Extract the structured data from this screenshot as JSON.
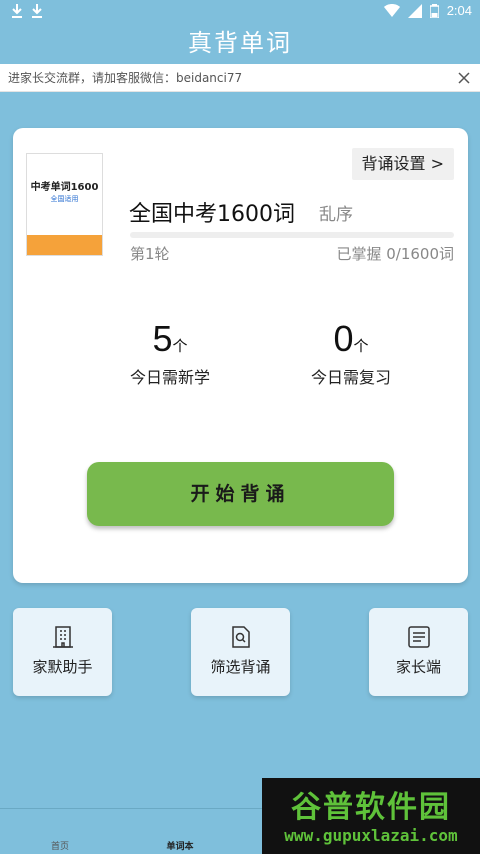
{
  "status_bar": {
    "time": "2:04"
  },
  "header": {
    "title": "真背单词"
  },
  "notice": {
    "text": "进家长交流群，请加客服微信：beidanci77"
  },
  "book": {
    "cover_title": "中考单词1600",
    "cover_subtitle": "全国适用",
    "name": "全国中考1600词",
    "order": "乱序",
    "round": "第1轮",
    "mastered": "已掌握 0/1600词",
    "progress_fraction": 0,
    "settings_label": "背诵设置 >"
  },
  "stats": {
    "new": {
      "value": "5",
      "unit": "个",
      "label": "今日需新学"
    },
    "review": {
      "value": "0",
      "unit": "个",
      "label": "今日需复习"
    }
  },
  "start_button": "开始背诵",
  "tools": [
    {
      "label": "家默助手",
      "icon": "building-icon"
    },
    {
      "label": "筛选背诵",
      "icon": "doc-search-icon"
    },
    {
      "label": "家长端",
      "icon": "list-doc-icon"
    }
  ],
  "bottom_nav": [
    {
      "label": "首页"
    },
    {
      "label": "单词本"
    }
  ],
  "watermark": {
    "title": "谷普软件园",
    "url": "www.gupuxlazai.com"
  },
  "colors": {
    "background": "#7fbfdc",
    "accent": "#78b94d",
    "cover_band": "#f5a23a"
  }
}
